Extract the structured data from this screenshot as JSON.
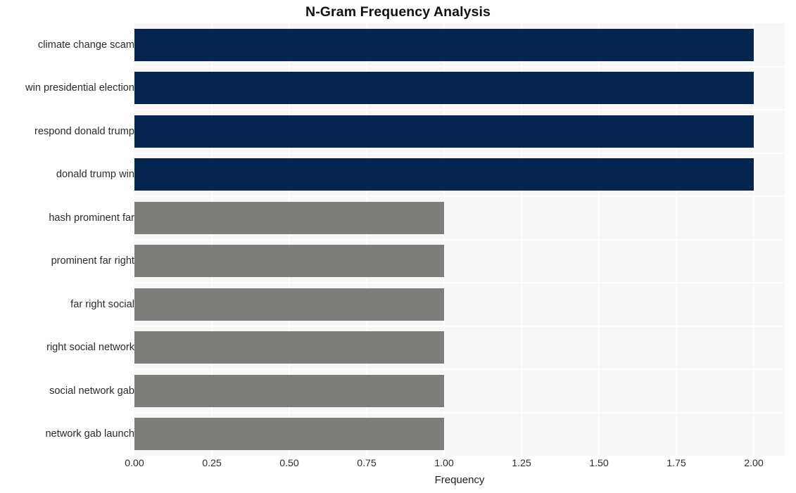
{
  "chart_data": {
    "type": "bar",
    "orientation": "horizontal",
    "title": "N-Gram Frequency Analysis",
    "xlabel": "Frequency",
    "ylabel": "",
    "xlim": [
      0,
      2.1
    ],
    "grid": true,
    "legend": null,
    "xticks": [
      "0.00",
      "0.25",
      "0.50",
      "0.75",
      "1.00",
      "1.25",
      "1.50",
      "1.75",
      "2.00"
    ],
    "xtick_values": [
      0,
      0.25,
      0.5,
      0.75,
      1.0,
      1.25,
      1.5,
      1.75,
      2.0
    ],
    "categories": [
      "climate change scam",
      "win presidential election",
      "respond donald trump",
      "donald trump win",
      "hash prominent far",
      "prominent far right",
      "far right social",
      "right social network",
      "social network gab",
      "network gab launch"
    ],
    "values": [
      2,
      2,
      2,
      2,
      1,
      1,
      1,
      1,
      1,
      1
    ],
    "bar_colors": [
      "#04254f",
      "#04254f",
      "#04254f",
      "#04254f",
      "#7d7d7a",
      "#7d7d7a",
      "#7d7d7a",
      "#7d7d7a",
      "#7d7d7a",
      "#7d7d7a"
    ]
  },
  "style": {
    "plot_background": "#f7f7f7",
    "figure_background": "#ffffff",
    "gridline_color": "#ffffff",
    "accent_primary": "#04254f",
    "accent_secondary": "#7d7d7a",
    "tick_label_color": "#2b2b2b",
    "title_color": "#111111"
  }
}
